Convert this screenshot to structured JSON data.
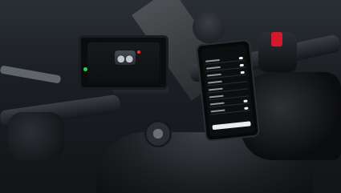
{
  "scene": {
    "description_icon": "motorcycle-cockpit-icon",
    "colors": {
      "road_stripe": "#6b6d6f",
      "indicator_green": "#31d04c",
      "switch_red": "#d21a2a"
    }
  },
  "dashboard": {
    "icons": [
      "motorcycle-icon",
      "status-dot-icon"
    ]
  },
  "phone": {
    "rows": [
      {
        "toggle": true
      },
      {
        "toggle": true
      },
      {
        "toggle": true
      },
      {
        "toggle": false
      },
      {
        "toggle": false
      },
      {
        "toggle": false
      },
      {
        "toggle": true
      },
      {
        "toggle": true
      }
    ]
  }
}
